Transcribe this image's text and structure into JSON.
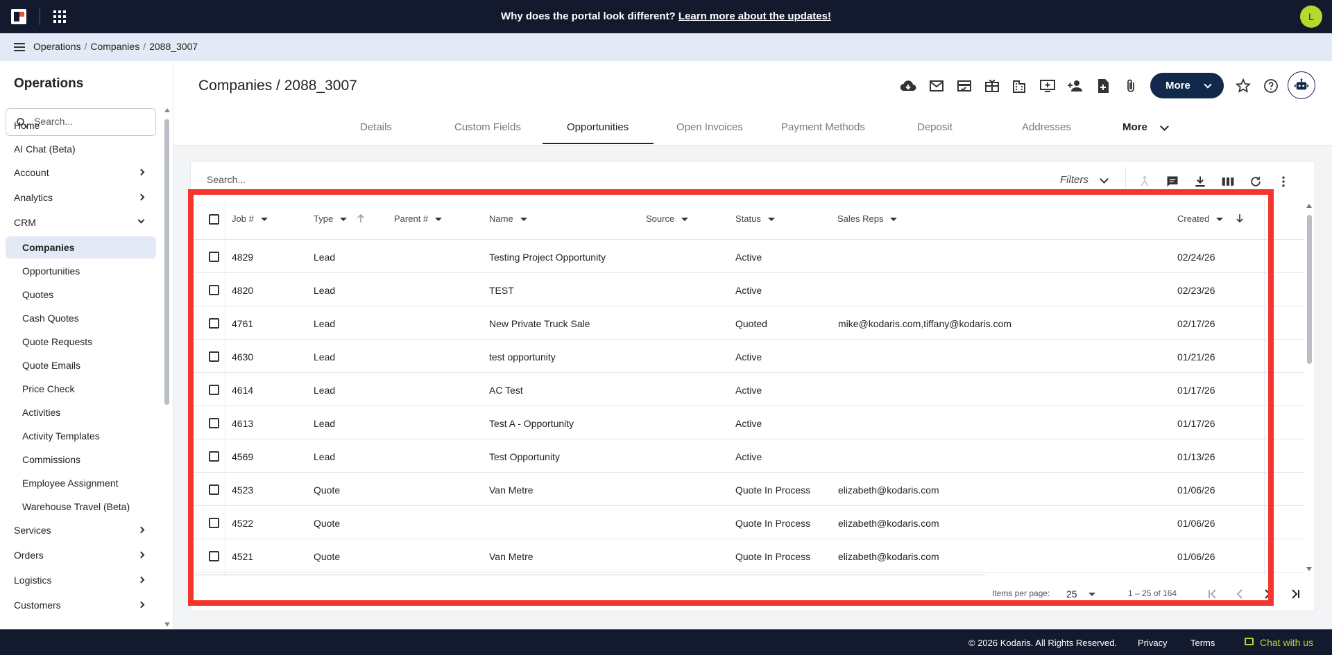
{
  "topbar": {
    "banner_text": "Why does the portal look different?",
    "banner_link": "Learn more about the updates!",
    "user_initial": "L"
  },
  "breadcrumb": [
    "Operations",
    "Companies",
    "2088_3007"
  ],
  "sidebar": {
    "title": "Operations",
    "search_placeholder": "Search...",
    "items": [
      {
        "label": "Home",
        "level": 0,
        "chevron": "none"
      },
      {
        "label": "AI Chat (Beta)",
        "level": 0,
        "chevron": "none"
      },
      {
        "label": "Account",
        "level": 0,
        "chevron": "right"
      },
      {
        "label": "Analytics",
        "level": 0,
        "chevron": "right"
      },
      {
        "label": "CRM",
        "level": 0,
        "chevron": "down"
      },
      {
        "label": "Companies",
        "level": 1,
        "active": true
      },
      {
        "label": "Opportunities",
        "level": 1
      },
      {
        "label": "Quotes",
        "level": 1
      },
      {
        "label": "Cash Quotes",
        "level": 1
      },
      {
        "label": "Quote Requests",
        "level": 1
      },
      {
        "label": "Quote Emails",
        "level": 1
      },
      {
        "label": "Price Check",
        "level": 1
      },
      {
        "label": "Activities",
        "level": 1
      },
      {
        "label": "Activity Templates",
        "level": 1
      },
      {
        "label": "Commissions",
        "level": 1
      },
      {
        "label": "Employee Assignment",
        "level": 1
      },
      {
        "label": "Warehouse Travel (Beta)",
        "level": 1
      },
      {
        "label": "Services",
        "level": 0,
        "chevron": "right"
      },
      {
        "label": "Orders",
        "level": 0,
        "chevron": "right"
      },
      {
        "label": "Logistics",
        "level": 0,
        "chevron": "right"
      },
      {
        "label": "Customers",
        "level": 0,
        "chevron": "right"
      }
    ]
  },
  "page": {
    "title": "Companies / 2088_3007",
    "more_label": "More",
    "toolbar_icons": [
      "cloud-download-icon",
      "mail-icon",
      "credit-card-icon",
      "gift-card-icon",
      "building-add-icon",
      "add-to-queue-icon",
      "person-add-icon",
      "note-add-icon",
      "attach-icon"
    ]
  },
  "tabs": [
    {
      "label": "Details"
    },
    {
      "label": "Custom Fields"
    },
    {
      "label": "Opportunities",
      "active": true
    },
    {
      "label": "Open Invoices"
    },
    {
      "label": "Payment Methods"
    },
    {
      "label": "Deposit"
    },
    {
      "label": "Addresses"
    }
  ],
  "tabs_more": "More",
  "table": {
    "search_placeholder": "Search...",
    "filters_label": "Filters",
    "columns": [
      "Job #",
      "Type",
      "Parent #",
      "Name",
      "Source",
      "Status",
      "Sales Reps",
      "Created"
    ],
    "rows": [
      {
        "job": "4829",
        "type": "Lead",
        "parent": "",
        "name": "Testing Project Opportunity",
        "source": "",
        "status": "Active",
        "reps": "",
        "created": "02/24/26"
      },
      {
        "job": "4820",
        "type": "Lead",
        "parent": "",
        "name": "TEST",
        "source": "",
        "status": "Active",
        "reps": "",
        "created": "02/23/26"
      },
      {
        "job": "4761",
        "type": "Lead",
        "parent": "",
        "name": "New Private Truck Sale",
        "source": "",
        "status": "Quoted",
        "reps": "mike@kodaris.com,tiffany@kodaris.com",
        "created": "02/17/26"
      },
      {
        "job": "4630",
        "type": "Lead",
        "parent": "",
        "name": "test opportunity",
        "source": "",
        "status": "Active",
        "reps": "",
        "created": "01/21/26"
      },
      {
        "job": "4614",
        "type": "Lead",
        "parent": "",
        "name": "AC Test",
        "source": "",
        "status": "Active",
        "reps": "",
        "created": "01/17/26"
      },
      {
        "job": "4613",
        "type": "Lead",
        "parent": "",
        "name": "Test A - Opportunity",
        "source": "",
        "status": "Active",
        "reps": "",
        "created": "01/17/26"
      },
      {
        "job": "4569",
        "type": "Lead",
        "parent": "",
        "name": "Test Opportunity",
        "source": "",
        "status": "Active",
        "reps": "",
        "created": "01/13/26"
      },
      {
        "job": "4523",
        "type": "Quote",
        "parent": "",
        "name": "Van Metre",
        "source": "",
        "status": "Quote In Process",
        "reps": "elizabeth@kodaris.com",
        "created": "01/06/26"
      },
      {
        "job": "4522",
        "type": "Quote",
        "parent": "",
        "name": "",
        "source": "",
        "status": "Quote In Process",
        "reps": "elizabeth@kodaris.com",
        "created": "01/06/26"
      },
      {
        "job": "4521",
        "type": "Quote",
        "parent": "",
        "name": "Van Metre",
        "source": "",
        "status": "Quote In Process",
        "reps": "elizabeth@kodaris.com",
        "created": "01/06/26"
      }
    ],
    "pager": {
      "items_label": "Items per page:",
      "page_size": "25",
      "range": "1 – 25 of 164"
    }
  },
  "footer": {
    "copyright": "© 2026 Kodaris. All Rights Reserved.",
    "privacy": "Privacy",
    "terms": "Terms",
    "chat": "Chat with us"
  },
  "colors": {
    "topbar": "#131a2d",
    "accent": "#13294b",
    "avatar": "#b5d931",
    "highlight": "#f4352e"
  }
}
